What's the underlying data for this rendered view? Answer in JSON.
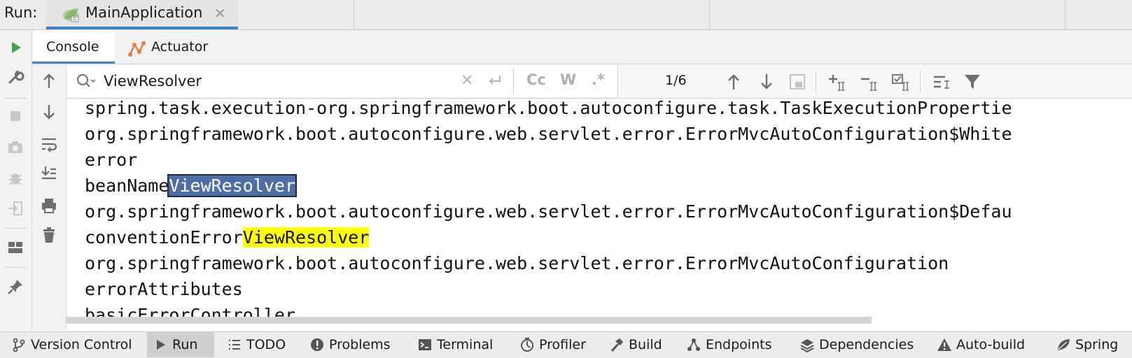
{
  "run_bar": {
    "label": "Run:",
    "tab_title": "MainApplication",
    "close_symbol": "✕"
  },
  "sub_tabs": [
    {
      "label": "Console",
      "active": true
    },
    {
      "label": "Actuator",
      "active": false
    }
  ],
  "search": {
    "value": "ViewResolver",
    "clear_symbol": "✕",
    "option_case": "Cc",
    "option_words": "W",
    "option_regex": ".*",
    "match_count": "1/6"
  },
  "console_lines": [
    {
      "pre": "spring.task.execution-org.springframework.boot.autoconfigure.task.TaskExecutionPropertie",
      "match": "",
      "post": ""
    },
    {
      "pre": "org.springframework.boot.autoconfigure.web.servlet.error.ErrorMvcAutoConfiguration$White",
      "match": "",
      "post": ""
    },
    {
      "pre": "error",
      "match": "",
      "post": ""
    },
    {
      "pre": "beanName",
      "match": "ViewResolver",
      "post": ""
    },
    {
      "pre": "org.springframework.boot.autoconfigure.web.servlet.error.ErrorMvcAutoConfiguration$Defau",
      "match": "",
      "post": ""
    },
    {
      "pre": "conventionError",
      "match": "ViewResolver",
      "post": ""
    },
    {
      "pre": "org.springframework.boot.autoconfigure.web.servlet.error.ErrorMvcAutoConfiguration",
      "match": "",
      "post": ""
    },
    {
      "pre": "errorAttributes",
      "match": "",
      "post": ""
    },
    {
      "pre": "basicErrorController",
      "match": "",
      "post": ""
    }
  ],
  "bottom_tabs": [
    {
      "label": "Version Control",
      "icon": "branch-icon"
    },
    {
      "label": "Run",
      "icon": "run-icon",
      "active": true
    },
    {
      "label": "TODO",
      "icon": "list-icon"
    },
    {
      "label": "Problems",
      "icon": "alert-icon"
    },
    {
      "label": "Terminal",
      "icon": "terminal-icon"
    },
    {
      "label": "Profiler",
      "icon": "profiler-icon"
    },
    {
      "label": "Build",
      "icon": "hammer-icon"
    },
    {
      "label": "Endpoints",
      "icon": "endpoints-icon"
    },
    {
      "label": "Dependencies",
      "icon": "layers-icon"
    },
    {
      "label": "Auto-build",
      "icon": "warning-icon"
    },
    {
      "label": "Spring",
      "icon": "leaf-icon"
    }
  ],
  "colors": {
    "accent": "#4083c9",
    "selected_match_bg": "#4e6ea6",
    "match_bg": "#ffff00",
    "run_green": "#3fa34d"
  }
}
